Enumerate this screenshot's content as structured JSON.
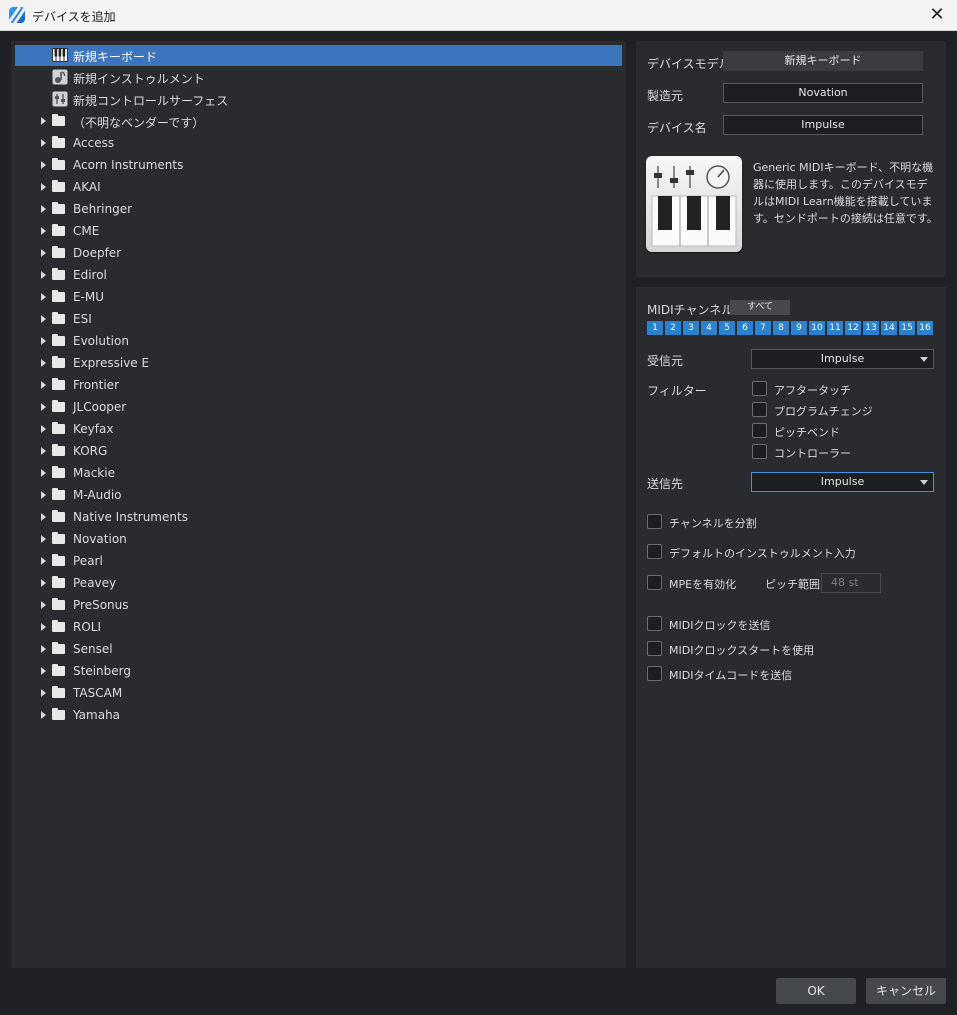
{
  "window": {
    "title": "デバイスを追加",
    "close_glyph": "✕"
  },
  "tree": {
    "special_items": [
      {
        "label": "新規キーボード",
        "icon": "piano-keys-icon"
      },
      {
        "label": "新規インストゥルメント",
        "icon": "instrument-icon"
      },
      {
        "label": "新規コントロールサーフェス",
        "icon": "control-surface-icon"
      }
    ],
    "vendors": [
      "（不明なベンダーです）",
      "Access",
      "Acorn Instruments",
      "AKAI",
      "Behringer",
      "CME",
      "Doepfer",
      "Edirol",
      "E-MU",
      "ESI",
      "Evolution",
      "Expressive E",
      "Frontier",
      "JLCooper",
      "Keyfax",
      "KORG",
      "Mackie",
      "M-Audio",
      "Native Instruments",
      "Novation",
      "Pearl",
      "Peavey",
      "PreSonus",
      "ROLI",
      "Sensel",
      "Steinberg",
      "TASCAM",
      "Yamaha"
    ]
  },
  "device": {
    "model_label": "デバイスモデル",
    "model_value": "新規キーボード",
    "maker_label": "製造元",
    "maker_value": "Novation",
    "name_label": "デバイス名",
    "name_value": "Impulse",
    "description": "Generic MIDIキーボード、不明な機器に使用します。このデバイスモデルはMIDI Learn機能を搭載しています。センドポートの接続は任意です。"
  },
  "settings": {
    "midi_channel_label": "MIDIチャンネル",
    "all_button": "すべて",
    "channels": [
      "1",
      "2",
      "3",
      "4",
      "5",
      "6",
      "7",
      "8",
      "9",
      "10",
      "11",
      "12",
      "13",
      "14",
      "15",
      "16"
    ],
    "receive_label": "受信元",
    "receive_value": "Impulse",
    "filter_label": "フィルター",
    "filters": [
      "アフタータッチ",
      "プログラムチェンジ",
      "ピッチベンド",
      "コントローラー"
    ],
    "send_label": "送信先",
    "send_value": "Impulse",
    "split_channels": "チャンネルを分割",
    "default_instrument_input": "デフォルトのインストゥルメント入力",
    "enable_mpe": "MPEを有効化",
    "pitch_range_label": "ピッチ範囲",
    "pitch_range_value": "48 st",
    "send_midi_clock": "MIDIクロックを送信",
    "use_midi_clock_start": "MIDIクロックスタートを使用",
    "send_midi_timecode": "MIDIタイムコードを送信"
  },
  "footer": {
    "ok": "OK",
    "cancel": "キャンセル"
  },
  "colors": {
    "accent": "#3c74bd",
    "channel": "#2c81cf",
    "background": "#202124",
    "panel": "#2a2b2e"
  }
}
